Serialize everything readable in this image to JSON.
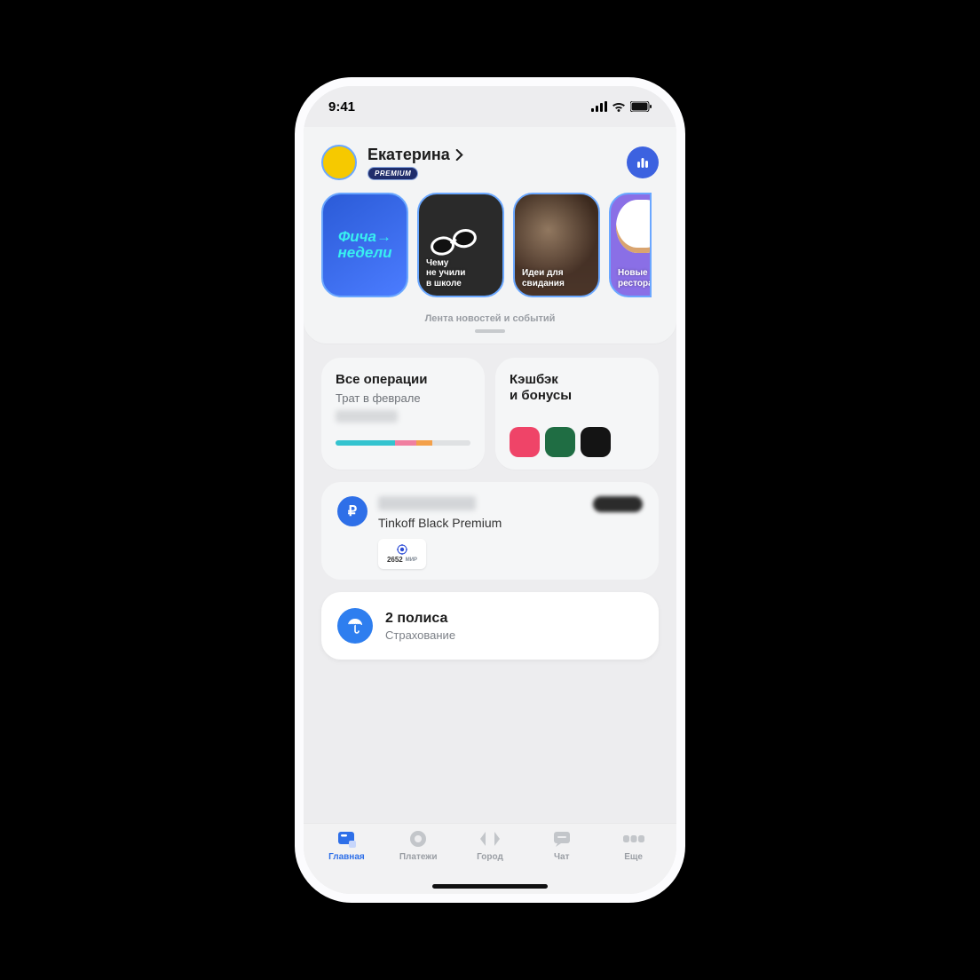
{
  "status": {
    "time": "9:41"
  },
  "header": {
    "name": "Екатерина",
    "badge": "PREMIUM"
  },
  "stories": [
    {
      "line1": "Фича→",
      "line2": "недели"
    },
    {
      "label": "Чему\nне учили\nв школе"
    },
    {
      "label": "Идеи для\nсвидания"
    },
    {
      "label": "Новые\nрестораь"
    }
  ],
  "feed_caption": "Лента новостей и событий",
  "ops": {
    "title": "Все операции",
    "subtitle": "Трат в феврале",
    "segments": [
      {
        "w": 44,
        "c": "#34c3cf"
      },
      {
        "w": 16,
        "c": "#f07fa0"
      },
      {
        "w": 12,
        "c": "#f3a04a"
      },
      {
        "w": 28,
        "c": "#dfe1e3"
      }
    ]
  },
  "cashback": {
    "title": "Кэшбэк\nи бонусы",
    "dots": [
      "#ef4468",
      "#1f6d43",
      "#141414"
    ]
  },
  "account": {
    "name": "Tinkoff Black Premium",
    "card_digits": "2652",
    "card_scheme": "МИР"
  },
  "insurance": {
    "title": "2 полиса",
    "subtitle": "Страхование"
  },
  "tabs": [
    {
      "label": "Главная",
      "active": true
    },
    {
      "label": "Платежи",
      "active": false
    },
    {
      "label": "Город",
      "active": false
    },
    {
      "label": "Чат",
      "active": false
    },
    {
      "label": "Еще",
      "active": false
    }
  ]
}
